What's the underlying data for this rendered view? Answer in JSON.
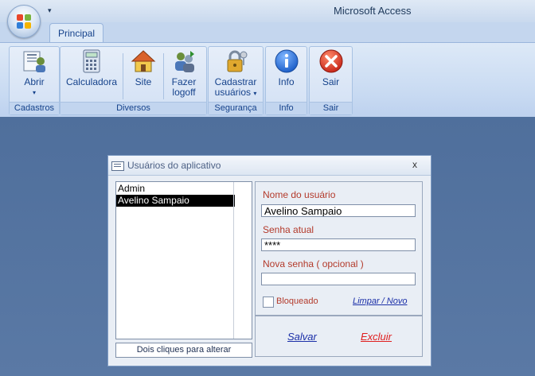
{
  "window": {
    "title": "Microsoft Access"
  },
  "ribbon": {
    "tab": "Principal",
    "groups": {
      "cadastros": {
        "label": "Cadastros",
        "abrir": "Abrir"
      },
      "diversos": {
        "label": "Diversos",
        "calculadora": "Calculadora",
        "site": "Site",
        "fazer": "Fazer",
        "logoff": "logoff"
      },
      "seguranca": {
        "label": "Segurança",
        "cadastrar": "Cadastrar",
        "usuarios": "usuários"
      },
      "info": {
        "label": "Info",
        "button": "Info"
      },
      "sair": {
        "label": "Sair",
        "button": "Sair"
      }
    }
  },
  "dialog": {
    "title": "Usuários do aplicativo",
    "close": "x",
    "users": [
      "Admin",
      "Avelino Sampaio"
    ],
    "selected_index": 1,
    "hint": "Dois cliques para alterar",
    "fields": {
      "name_label": "Nome do usuário",
      "name_value": "Avelino Sampaio",
      "password_label": "Senha atual",
      "password_value": "****",
      "new_password_label": "Nova senha ( opcional )",
      "new_password_value": ""
    },
    "blocked_label": "Bloqueado",
    "clear_new": "Limpar / Novo",
    "save": "Salvar",
    "delete": "Excluir"
  },
  "colors": {
    "workspace": "#55749f",
    "label_red": "#b33a2b",
    "link_blue": "#1b2fa8",
    "link_red": "#e01f1f"
  }
}
